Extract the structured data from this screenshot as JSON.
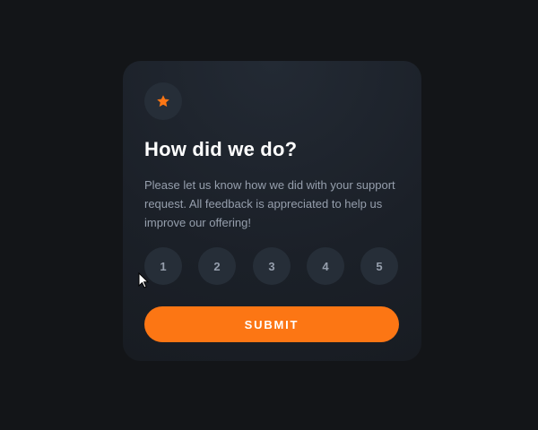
{
  "card": {
    "icon": "star-icon",
    "title": "How did we do?",
    "description": "Please let us know how we did with your support request. All feedback is appreciated to help us improve our offering!",
    "ratings": [
      "1",
      "2",
      "3",
      "4",
      "5"
    ],
    "submit_label": "SUBMIT"
  },
  "colors": {
    "page_background": "#131518",
    "card_background": "#1b2028",
    "accent_orange": "#fc7614",
    "circle_background": "#262e38",
    "muted_text": "#969fad",
    "title_text": "#ffffff"
  },
  "cursor": {
    "icon": "mouse-pointer-icon"
  }
}
